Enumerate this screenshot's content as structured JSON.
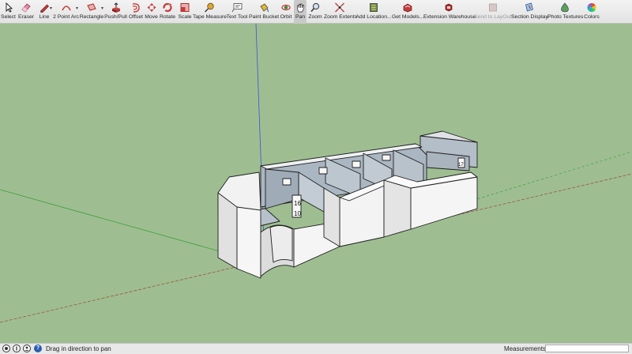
{
  "toolbar": {
    "tools": [
      {
        "id": "select",
        "label": "Select"
      },
      {
        "id": "eraser",
        "label": "Eraser"
      },
      {
        "id": "line",
        "label": "Line"
      },
      {
        "id": "arc",
        "label": "2 Point Arc"
      },
      {
        "id": "rectangle",
        "label": "Rectangle"
      },
      {
        "id": "pushpull",
        "label": "Push/Pull"
      },
      {
        "id": "offset",
        "label": "Offset"
      },
      {
        "id": "move",
        "label": "Move"
      },
      {
        "id": "rotate",
        "label": "Rotate"
      },
      {
        "id": "scale",
        "label": "Scale"
      },
      {
        "id": "tape",
        "label": "Tape Measure"
      },
      {
        "id": "text",
        "label": "Text Tool"
      },
      {
        "id": "paint",
        "label": "Paint Bucket"
      },
      {
        "id": "orbit",
        "label": "Orbit"
      },
      {
        "id": "pan",
        "label": "Pan"
      },
      {
        "id": "zoom",
        "label": "Zoom"
      },
      {
        "id": "extents",
        "label": "Zoom Extents"
      },
      {
        "id": "addlocation",
        "label": "Add Location..."
      },
      {
        "id": "getmodels",
        "label": "Get Models..."
      },
      {
        "id": "warehouse",
        "label": "Extension Warehouse"
      },
      {
        "id": "layout",
        "label": "Send to LayOut"
      },
      {
        "id": "section",
        "label": "Section Display"
      },
      {
        "id": "phototex",
        "label": "Photo Textures"
      },
      {
        "id": "colors",
        "label": "Colors"
      }
    ],
    "active_tool": "pan",
    "disabled_tool": "layout"
  },
  "status": {
    "message": "Drag in direction to pan",
    "measurements_label": "Measurements",
    "measurements_value": ""
  },
  "icons": {
    "status": [
      "geo-location-icon",
      "credits-icon",
      "user-icon",
      "help-icon"
    ],
    "status_help_glyph": "?"
  },
  "colors": {
    "ground": "#9ebe91",
    "wall_face": "#f5f5f5",
    "wall_interior": "#b9c3cc",
    "axis_red": "#a0523f",
    "axis_green": "#3c9c3c",
    "axis_blue": "#3a53d8"
  },
  "room_signs": [
    "16",
    "10",
    "17"
  ]
}
